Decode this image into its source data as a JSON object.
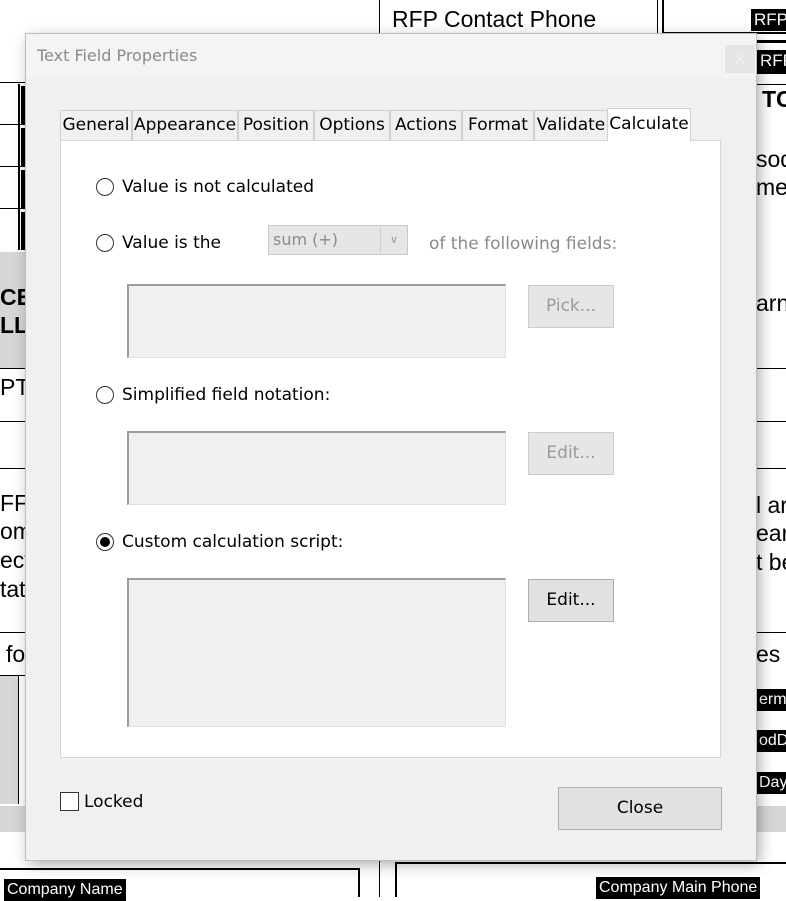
{
  "background": {
    "top_label": "RFP Contact Phone",
    "top_field_1": "RFP",
    "top_field_2": "RFP",
    "heading_partial": "TC",
    "left_frag_ce": "CE",
    "left_frag_ll": "LL",
    "left_frag_pt": "PT",
    "right_frag_sod": "sod",
    "right_frag_me": "me",
    "right_frag_arn": "arn",
    "para_left": [
      "FF",
      "om",
      "ect",
      "tate"
    ],
    "para_right": [
      "l ar",
      "earl",
      "t be"
    ],
    "fo_frag": "fo",
    "es_frag": "es",
    "right_fields": [
      "erm",
      "odD",
      "Days"
    ],
    "bottom_left_field": "Company Name",
    "bottom_right_field": "Company Main Phone"
  },
  "dialog": {
    "title": "Text Field Properties",
    "close_glyph": "×",
    "tabs": [
      "General",
      "Appearance",
      "Position",
      "Options",
      "Actions",
      "Format",
      "Validate",
      "Calculate"
    ],
    "active_tab": "Calculate",
    "options": {
      "not_calculated": "Value is not calculated",
      "value_is_the": "Value is the",
      "operation_selected": "sum (+)",
      "of_following": "of the following fields:",
      "pick_button": "Pick...",
      "simplified": "Simplified field notation:",
      "edit_simplified_button": "Edit...",
      "custom": "Custom calculation script:",
      "edit_custom_button": "Edit..."
    },
    "selected_option": "custom",
    "locked_label": "Locked",
    "locked_checked": false,
    "close_button": "Close"
  }
}
